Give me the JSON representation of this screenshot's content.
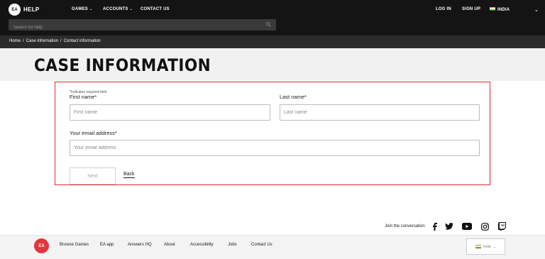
{
  "brand": {
    "logo_text": "EA",
    "help_label": "HELP"
  },
  "nav": {
    "games": "GAMES",
    "accounts": "ACCOUNTS",
    "contact": "CONTACT US",
    "login": "LOG IN",
    "signup": "SIGN UP",
    "region": "INDIA"
  },
  "search": {
    "placeholder": "Search for help"
  },
  "breadcrumb": {
    "items": [
      "Home",
      "Case information",
      "Contact information"
    ],
    "separator": "/"
  },
  "page": {
    "title": "CASE INFORMATION"
  },
  "form": {
    "required_note": "*Indicates required field",
    "first_name_label": "First name*",
    "first_name_placeholder": "First name",
    "last_name_label": "Last name*",
    "last_name_placeholder": "Last name",
    "email_label": "Your email address*",
    "email_placeholder": "Your email address",
    "next_label": "Next",
    "back_label": "Back",
    "border_color": "#e0262f"
  },
  "social": {
    "join_text": "Join the conversation",
    "icons": [
      "facebook-icon",
      "twitter-icon",
      "youtube-icon",
      "instagram-icon",
      "twitch-icon"
    ]
  },
  "footer": {
    "logo_text": "EA",
    "links": [
      "Browse Games",
      "EA app",
      "Answers HQ",
      "About",
      "Accessibility",
      "Jobs",
      "Contact Us"
    ],
    "region_select": "India",
    "logo_color": "#e3353d"
  }
}
